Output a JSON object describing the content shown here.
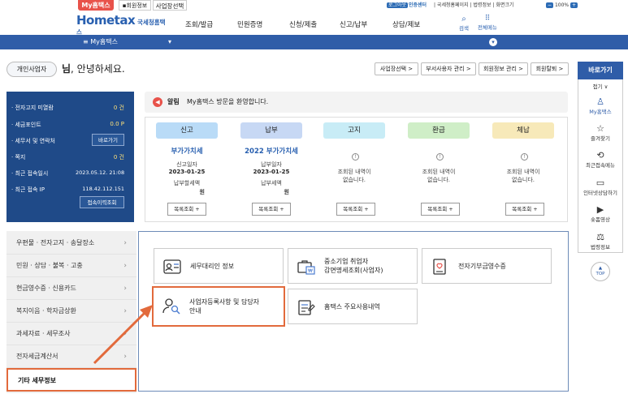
{
  "topbar": {
    "my_tab": "My홈택스",
    "info_tab": "회원정보",
    "biz_tab": "사업장선택",
    "logout": "로그아웃",
    "cert_center": "인증센터",
    "util_links": "| 국세청홈페이지 | 법령정보 | 화면크기",
    "zoom": "100%"
  },
  "header": {
    "logo_main": "Hometax",
    "logo_sub": "국세청홈택스",
    "nav": [
      "조회/발급",
      "민원증명",
      "신청/제출",
      "신고/납부",
      "상담/제보"
    ],
    "search_label": "검색",
    "allmenu_label": "전체메뉴"
  },
  "mybar": {
    "label": "My홈택스"
  },
  "greeting": {
    "user_type": "개인사업자",
    "name": "님",
    "hello": ", 안녕하세요.",
    "buttons": [
      "사업장선택 >",
      "부서사용자 관리 >",
      "회원정보 관리 >",
      "회원탈퇴 >"
    ]
  },
  "summary": {
    "rows": [
      {
        "label": "· 전자고지 미열람",
        "value": "0 건"
      },
      {
        "label": "· 세금포인트",
        "value": "0.0 P"
      },
      {
        "label": "· 세무서 및 연락처",
        "value": ""
      },
      {
        "label": "· 쪽지",
        "value": "0 건"
      },
      {
        "label": "· 최근 접속일시",
        "value": "2023.05.12.  21:08"
      },
      {
        "label": "· 최근 접속 IP",
        "value": "118.42.112.151"
      }
    ],
    "btn_view": "바로가기",
    "btn_history": "접속이력조회"
  },
  "notice": {
    "tag": "알림",
    "text": "My홈택스 방문을 환영합니다."
  },
  "cards": [
    {
      "head": "신고",
      "color": "#b9dbf7",
      "title": "부가가치세",
      "l1": "신고일자",
      "d1": "2023-01-25",
      "l2": "납부할세액",
      "d2": "원",
      "btn": "목록조회 +"
    },
    {
      "head": "납부",
      "color": "#c7d8f4",
      "title": "2022 부가가치세",
      "l1": "납부일자",
      "d1": "2023-01-25",
      "l2": "납부세액",
      "d2": "원",
      "btn": "목록조회 +"
    },
    {
      "head": "고지",
      "color": "#c8ecf6",
      "title": "",
      "l1": "조회된 내역이",
      "d1": "없습니다.",
      "l2": "",
      "d2": "",
      "btn": "목록조회 +"
    },
    {
      "head": "환급",
      "color": "#cfeec7",
      "title": "",
      "l1": "조회된 내역이",
      "d1": "없습니다.",
      "l2": "",
      "d2": "",
      "btn": "목록조회 +"
    },
    {
      "head": "체납",
      "color": "#f7e9b9",
      "title": "",
      "l1": "조회된 내역이",
      "d1": "없습니다.",
      "l2": "",
      "d2": "",
      "btn": "목록조회 +"
    }
  ],
  "menu": [
    "우편물 · 전자고지 · 송달장소",
    "민원 · 상담 · 불복 · 고충",
    "현금영수증 · 신용카드",
    "복지이음 · 학자금상환",
    "과세자료 · 세무조사",
    "전자세금계산서",
    "기타 세무정보"
  ],
  "tiles": [
    {
      "label": "세무대리인 정보",
      "icon": "id-card-icon"
    },
    {
      "label": "중소기업 취업자\n감면명세조회(사업자)",
      "icon": "briefcase-icon"
    },
    {
      "label": "전자기부금영수증",
      "icon": "donation-receipt-icon"
    },
    {
      "label": "사업자등록사항 및 담당자\n안내",
      "icon": "person-search-icon"
    },
    {
      "label": "홈택스 주요사용내역",
      "icon": "history-doc-icon"
    }
  ],
  "quick": {
    "title": "바로가기",
    "fold": "접기 ∨",
    "items": [
      {
        "label": "My홈택스",
        "icon": "person-icon"
      },
      {
        "label": "즐겨찾기",
        "icon": "star-icon"
      },
      {
        "label": "최근접속메뉴",
        "icon": "recent-icon"
      },
      {
        "label": "인터넷상담하기",
        "icon": "monitor-icon"
      },
      {
        "label": "숏폼영상",
        "icon": "play-icon"
      },
      {
        "label": "법령정보",
        "icon": "gavel-icon"
      }
    ],
    "top": "TOP"
  },
  "colors": {
    "brand": "#2f5da8",
    "highlight": "#e26a3c"
  }
}
